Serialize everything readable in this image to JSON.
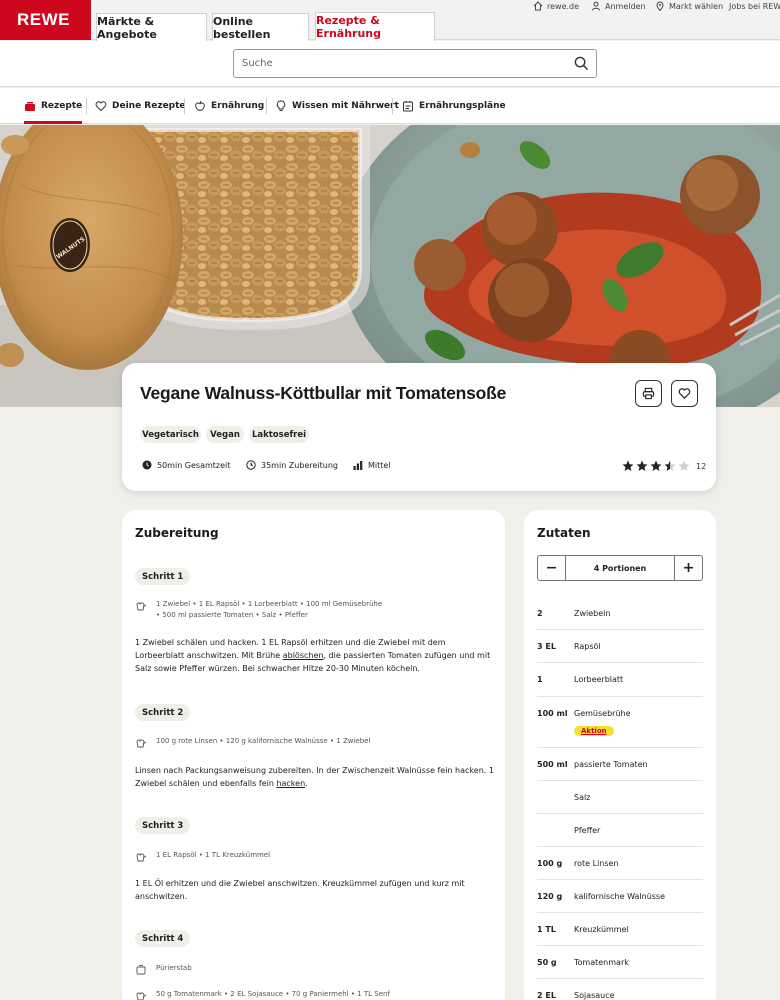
{
  "header": {
    "logo": "REWE",
    "tabs": [
      "Märkte & Angebote",
      "Online bestellen",
      "Rezepte & Ernährung"
    ],
    "utility": [
      "rewe.de",
      "Anmelden",
      "Markt wählen",
      "Jobs bei REWE"
    ]
  },
  "search": {
    "placeholder": "Suche"
  },
  "subnav": [
    "Rezepte",
    "Deine Rezepte",
    "Ernährung",
    "Wissen mit Nährwert",
    "Ernährungspläne"
  ],
  "recipe": {
    "title": "Vegane Walnuss-Köttbullar mit Tomatensoße",
    "tags": [
      "Vegetarisch",
      "Vegan",
      "Laktosefrei"
    ],
    "total_time": "50min Gesamtzeit",
    "prep_time": "35min Zubereitung",
    "difficulty": "Mittel",
    "rating": 3.5,
    "rating_count": "12",
    "hero_label": "WALNUTS"
  },
  "preparation": {
    "heading": "Zubereitung",
    "steps": [
      {
        "label": "Schritt 1",
        "ingredients_l1": "1 Zwiebel  •  1 EL Rapsöl  •  1 Lorbeerblatt  •  100 ml Gemüsebrühe",
        "ingredients_l2": "•  500 ml passierte Tomaten  •  Salz  •  Pfeffer",
        "text_a": "1 Zwiebel schälen und hacken. 1 EL Rapsöl erhitzen und die Zwiebel mit dem Lorbeerblatt anschwitzen. Mit Brühe ",
        "link": "ablöschen",
        "text_b": ", die passierten Tomaten zufügen und mit Salz sowie Pfeffer würzen. Bei schwacher Hitze 20-30 Minuten köcheln."
      },
      {
        "label": "Schritt 2",
        "ingredients_l1": "100 g rote Linsen  •  120 g kalifornische Walnüsse  •  1 Zwiebel",
        "text_a": "Linsen nach Packungsanweisung zubereiten. In der Zwischenzeit Walnüsse fein hacken. 1 Zwiebel schälen und ebenfalls fein ",
        "link": "hacken",
        "text_b": "."
      },
      {
        "label": "Schritt 3",
        "ingredients_l1": "1 EL Rapsöl  •  1 TL Kreuzkümmel",
        "text_a": "1 EL Öl erhitzen und die Zwiebel anschwitzen. Kreuzkümmel zufügen und kurz mit anschwitzen."
      },
      {
        "label": "Schritt 4",
        "tool": "Pürierstab",
        "ingredients_l1": "50 g Tomatenmark  •  2 EL Sojasauce  •  70 g Paniermehl  •  1 TL Senf"
      }
    ]
  },
  "ingredients": {
    "heading": "Zutaten",
    "portions": "4 Portionen",
    "minus": "−",
    "plus": "+",
    "badge": "Aktion",
    "items": [
      {
        "qty": "2",
        "name": "Zwiebeln"
      },
      {
        "qty": "3 EL",
        "name": "Rapsöl"
      },
      {
        "qty": "1",
        "name": "Lorbeerblatt"
      },
      {
        "qty": "100 ml",
        "name": "Gemüsebrühe"
      },
      {
        "qty": "500 ml",
        "name": "passierte Tomaten"
      },
      {
        "qty": "",
        "name": "Salz"
      },
      {
        "qty": "",
        "name": "Pfeffer"
      },
      {
        "qty": "100 g",
        "name": "rote Linsen"
      },
      {
        "qty": "120 g",
        "name": "kalifornische Walnüsse"
      },
      {
        "qty": "1 TL",
        "name": "Kreuzkümmel"
      },
      {
        "qty": "50 g",
        "name": "Tomatenmark"
      },
      {
        "qty": "2 EL",
        "name": "Sojasauce"
      }
    ]
  },
  "colors": {
    "brand": "#cc071e",
    "tag_bg": "#efefe9",
    "aktion": "#f9df2c",
    "page_bg": "#f0efe9"
  }
}
